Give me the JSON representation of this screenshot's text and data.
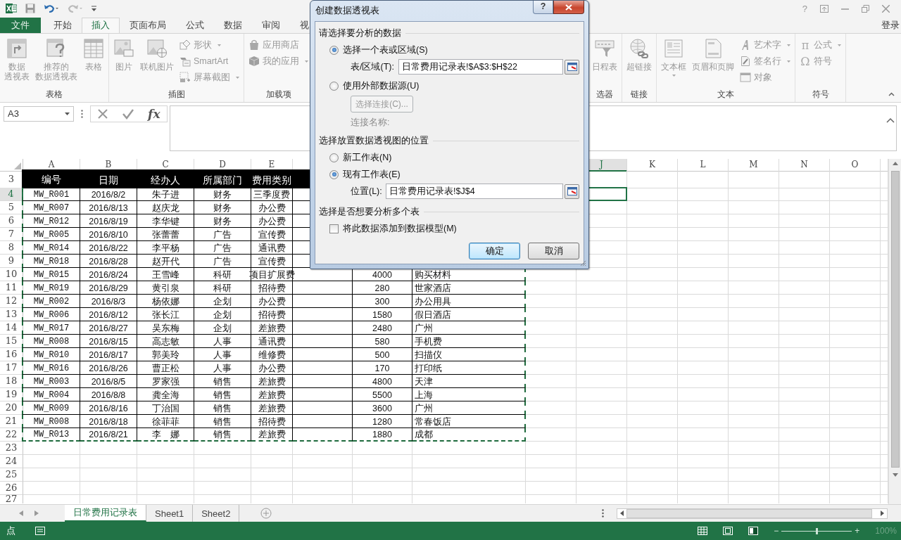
{
  "quick_access": {
    "help": "?",
    "account": "登录"
  },
  "tabs": [
    {
      "label": "文件",
      "kind": "file",
      "selected": false
    },
    {
      "label": "开始",
      "kind": "tab",
      "selected": false
    },
    {
      "label": "插入",
      "kind": "tab",
      "selected": true
    },
    {
      "label": "页面布局",
      "kind": "tab",
      "selected": false
    },
    {
      "label": "公式",
      "kind": "tab",
      "selected": false
    },
    {
      "label": "数据",
      "kind": "tab",
      "selected": false
    },
    {
      "label": "审阅",
      "kind": "tab",
      "selected": false
    },
    {
      "label": "视",
      "kind": "tab",
      "selected": false
    }
  ],
  "ribbon": {
    "left_groups": [
      {
        "label": "表格",
        "items": [
          {
            "kind": "large",
            "lines": [
              "数据",
              "透视表"
            ],
            "dropdown": false
          },
          {
            "kind": "large",
            "lines": [
              "推荐的",
              "数据透视表"
            ],
            "dropdown": false
          },
          {
            "kind": "large",
            "lines": [
              "表格"
            ],
            "dropdown": false
          }
        ]
      },
      {
        "label": "插图",
        "items": [
          {
            "kind": "large",
            "lines": [
              "图片"
            ],
            "dropdown": false
          },
          {
            "kind": "large",
            "lines": [
              "联机图片"
            ],
            "dropdown": false
          },
          {
            "kind": "stack",
            "items": [
              {
                "label": "形状",
                "dropdown": true
              },
              {
                "label": "SmartArt",
                "dropdown": false
              },
              {
                "label": "屏幕截图",
                "dropdown": true
              }
            ]
          }
        ]
      },
      {
        "label": "加载项",
        "items": [
          {
            "kind": "stack",
            "items": [
              {
                "label": "应用商店",
                "dropdown": false
              },
              {
                "label": "我的应用",
                "dropdown": true
              }
            ]
          }
        ]
      }
    ],
    "right_groups": [
      {
        "label": "选器",
        "items": [
          {
            "kind": "large",
            "lines": [
              "日程表"
            ],
            "dropdown": false
          }
        ]
      },
      {
        "label": "链接",
        "items": [
          {
            "kind": "large",
            "lines": [
              "超链接"
            ],
            "dropdown": false
          }
        ]
      },
      {
        "label": "文本",
        "items": [
          {
            "kind": "large",
            "lines": [
              "文本框"
            ],
            "dropdown": true
          },
          {
            "kind": "large",
            "lines": [
              "页眉和页脚"
            ],
            "dropdown": false
          },
          {
            "kind": "stack",
            "items": [
              {
                "label": "艺术字",
                "dropdown": true
              },
              {
                "label": "签名行",
                "dropdown": true
              },
              {
                "label": "对象",
                "dropdown": false
              }
            ]
          }
        ]
      },
      {
        "label": "符号",
        "items": [
          {
            "kind": "stack",
            "items": [
              {
                "label": "公式",
                "glyph": "π",
                "dropdown": true
              },
              {
                "label": "符号",
                "glyph": "Ω",
                "dropdown": false
              }
            ]
          }
        ]
      }
    ]
  },
  "formula_bar": {
    "name_box": "A3",
    "fx": "fx"
  },
  "sheet": {
    "columns": [
      {
        "label": "A",
        "selected": false
      },
      {
        "label": "B",
        "selected": false
      },
      {
        "label": "C",
        "selected": false
      },
      {
        "label": "D",
        "selected": false
      },
      {
        "label": "E",
        "selected": false
      },
      null,
      null,
      null,
      null,
      {
        "label": "J",
        "selected": true
      },
      {
        "label": "K",
        "selected": false
      },
      {
        "label": "L",
        "selected": false
      },
      {
        "label": "M",
        "selected": false
      },
      {
        "label": "N",
        "selected": false
      },
      {
        "label": "O",
        "selected": false
      }
    ],
    "rows": [
      {
        "num": "3",
        "kind": "header",
        "selected": false,
        "cells": [
          "编号",
          "日期",
          "经办人",
          "所属部门",
          "费用类别",
          null,
          null,
          null
        ]
      },
      {
        "num": "4",
        "kind": "data",
        "selected": true,
        "cells": [
          "MW_R001",
          "2016/8/2",
          "朱子进",
          "财务",
          "三季度费",
          null,
          null,
          null
        ]
      },
      {
        "num": "5",
        "kind": "data",
        "selected": false,
        "cells": [
          "MW_R007",
          "2016/8/13",
          "赵庆龙",
          "财务",
          "办公费",
          null,
          null,
          null
        ]
      },
      {
        "num": "6",
        "kind": "data",
        "selected": false,
        "cells": [
          "MW_R012",
          "2016/8/19",
          "李华键",
          "财务",
          "办公费",
          null,
          null,
          null
        ]
      },
      {
        "num": "7",
        "kind": "data",
        "selected": false,
        "cells": [
          "MW_R005",
          "2016/8/10",
          "张蕾蕾",
          "广告",
          "宣传费",
          null,
          null,
          null
        ]
      },
      {
        "num": "8",
        "kind": "data",
        "selected": false,
        "cells": [
          "MW_R014",
          "2016/8/22",
          "李平杨",
          "广告",
          "通讯费",
          null,
          null,
          null
        ]
      },
      {
        "num": "9",
        "kind": "data",
        "selected": false,
        "cells": [
          "MW_R018",
          "2016/8/28",
          "赵开代",
          "广告",
          "宣传费",
          null,
          null,
          null
        ]
      },
      {
        "num": "10",
        "kind": "data",
        "selected": false,
        "cells": [
          "MW_R015",
          "2016/8/24",
          "王雪峰",
          "科研",
          "项目扩展费",
          null,
          "4000",
          "购买材料"
        ]
      },
      {
        "num": "11",
        "kind": "data",
        "selected": false,
        "cells": [
          "MW_R019",
          "2016/8/29",
          "黄引泉",
          "科研",
          "招待费",
          null,
          "280",
          "世家酒店"
        ]
      },
      {
        "num": "12",
        "kind": "data",
        "selected": false,
        "cells": [
          "MW_R002",
          "2016/8/3",
          "杨依娜",
          "企划",
          "办公费",
          null,
          "300",
          "办公用具"
        ]
      },
      {
        "num": "13",
        "kind": "data",
        "selected": false,
        "cells": [
          "MW_R006",
          "2016/8/12",
          "张长江",
          "企划",
          "招待费",
          null,
          "1580",
          "假日酒店"
        ]
      },
      {
        "num": "14",
        "kind": "data",
        "selected": false,
        "cells": [
          "MW_R017",
          "2016/8/27",
          "吴东梅",
          "企划",
          "差旅费",
          null,
          "2480",
          "广州"
        ]
      },
      {
        "num": "15",
        "kind": "data",
        "selected": false,
        "cells": [
          "MW_R008",
          "2016/8/15",
          "高志敏",
          "人事",
          "通讯费",
          null,
          "580",
          "手机费"
        ]
      },
      {
        "num": "16",
        "kind": "data",
        "selected": false,
        "cells": [
          "MW_R010",
          "2016/8/17",
          "郭美玲",
          "人事",
          "维修费",
          null,
          "500",
          "扫描仪"
        ]
      },
      {
        "num": "17",
        "kind": "data",
        "selected": false,
        "cells": [
          "MW_R016",
          "2016/8/26",
          "曹正松",
          "人事",
          "办公费",
          null,
          "170",
          "打印纸"
        ]
      },
      {
        "num": "18",
        "kind": "data",
        "selected": false,
        "cells": [
          "MW_R003",
          "2016/8/5",
          "罗家强",
          "销售",
          "差旅费",
          null,
          "4800",
          "天津"
        ]
      },
      {
        "num": "19",
        "kind": "data",
        "selected": false,
        "cells": [
          "MW_R004",
          "2016/8/8",
          "龚全海",
          "销售",
          "差旅费",
          null,
          "5500",
          "上海"
        ]
      },
      {
        "num": "20",
        "kind": "data",
        "selected": false,
        "cells": [
          "MW_R009",
          "2016/8/16",
          "丁治国",
          "销售",
          "差旅费",
          null,
          "3600",
          "广州"
        ]
      },
      {
        "num": "21",
        "kind": "data",
        "selected": false,
        "cells": [
          "MW_R008",
          "2016/8/18",
          "徐菲菲",
          "销售",
          "招待费",
          null,
          "1280",
          "常春饭店"
        ]
      },
      {
        "num": "22",
        "kind": "data",
        "selected": false,
        "cells": [
          "MW_R013",
          "2016/8/21",
          "李　娜",
          "销售",
          "差旅费",
          null,
          "1880",
          "成都"
        ]
      },
      {
        "num": "23",
        "kind": "empty",
        "selected": false
      },
      {
        "num": "24",
        "kind": "empty",
        "selected": false
      },
      {
        "num": "25",
        "kind": "empty",
        "selected": false
      },
      {
        "num": "26",
        "kind": "empty",
        "selected": false
      },
      {
        "num": "27",
        "kind": "empty",
        "selected": false
      }
    ]
  },
  "sheet_tabs": [
    {
      "label": "日常费用记录表",
      "selected": true
    },
    {
      "label": "Sheet1",
      "selected": false
    },
    {
      "label": "Sheet2",
      "selected": false
    }
  ],
  "status_bar": {
    "mode": "点",
    "zoom_minus": "−",
    "zoom_slider": {
      "level": 0.5
    },
    "zoom_plus": "+",
    "zoom": "100%"
  },
  "dialog": {
    "title": "创建数据透视表",
    "help": "?",
    "data_section": {
      "heading": "请选择要分析的数据",
      "options": [
        {
          "label": "选择一个表或区域(S)",
          "selected": true
        },
        {
          "label": "使用外部数据源(U)",
          "selected": false
        }
      ],
      "range_label": "表/区域(T):",
      "range_value": "日常费用记录表!$A$3:$H$22",
      "connection_button": {
        "label": "选择连接(C)...",
        "disabled": true
      },
      "connection_name_label": "连接名称:"
    },
    "location_section": {
      "heading": "选择放置数据透视图的位置",
      "options": [
        {
          "label": "新工作表(N)",
          "selected": false
        },
        {
          "label": "现有工作表(E)",
          "selected": true
        }
      ],
      "location_label": "位置(L):",
      "location_value": "日常费用记录表!$J$4"
    },
    "multi_section": {
      "heading": "选择是否想要分析多个表",
      "checkbox": {
        "label": "将此数据添加到数据模型(M)",
        "checked": false
      }
    },
    "buttons": [
      {
        "label": "确定",
        "kind": "default"
      },
      {
        "label": "取消",
        "kind": "normal"
      }
    ]
  }
}
